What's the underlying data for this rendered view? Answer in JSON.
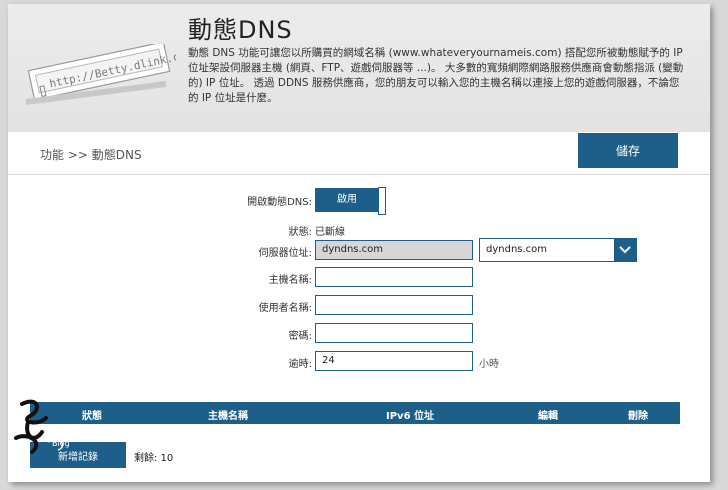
{
  "header": {
    "title": "動態DNS",
    "description": "動態 DNS 功能可讓您以所購買的網域名稱 (www.whateveryournameis.com) 搭配您所被動態賦予的 IP 位址架設伺服器主機 (網頁、FTP、遊戲伺服器等 ...)。 大多數的寬頻網際網路服務供應商會動態指派 (變動的) IP 位址。 透過 DDNS 服務供應商，您的朋友可以輸入您的主機名稱以連接上您的遊戲伺服器，不論您的 IP 位址是什麼。",
    "illustration_url": "http://Betty.dlink.com"
  },
  "breadcrumb": "功能 >> 動態DNS",
  "save_label": "儲存",
  "form": {
    "enable_label": "開啟動態DNS:",
    "enable_value": "啟用",
    "status_label": "狀態:",
    "status_value": "已斷線",
    "server_label": "伺服器位址:",
    "server_value": "dyndns.com",
    "server_select": "dyndns.com",
    "host_label": "主機名稱:",
    "host_value": "",
    "user_label": "使用者名稱:",
    "user_value": "",
    "password_label": "密碼:",
    "password_value": "",
    "timeout_label": "逾時:",
    "timeout_value": "24",
    "timeout_unit": "小時"
  },
  "table": {
    "headers": [
      "狀態",
      "主機名稱",
      "IPv6 位址",
      "編輯",
      "刪除"
    ]
  },
  "add_label": "新增記錄",
  "remaining_text": "剩餘: 10",
  "colors": {
    "accent": "#1e5f8a",
    "header_bg": "#e6e6e6"
  }
}
